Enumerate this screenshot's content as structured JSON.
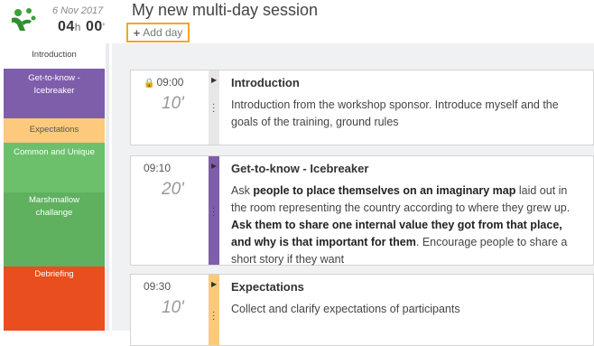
{
  "header": {
    "date": "6 Nov 2017",
    "hours": "04",
    "hours_unit": "h",
    "minutes": "00",
    "minutes_unit": "'",
    "title": "My new multi-day session",
    "add_day_label": "Add day"
  },
  "colors": {
    "accent": "#f5a623",
    "introduction": "#ffffff",
    "get_to_know": "#7e5eab",
    "expectations": "#fcc97d",
    "common_unique": "#6cc06c",
    "marshmallow": "#5fb05f",
    "debriefing": "#e94e1e"
  },
  "timeline": [
    {
      "label": "Introduction"
    },
    {
      "label": "Get-to-know - Icebreaker"
    },
    {
      "label": "Expectations"
    },
    {
      "label": "Common and Unique"
    },
    {
      "label": "Marshmallow challange"
    },
    {
      "label": "Debriefing"
    }
  ],
  "cards": [
    {
      "time": "09:00",
      "locked": true,
      "duration": "10'",
      "title": "Introduction",
      "description": "Introduction from the workshop sponsor. Introduce myself and the goals of the training, ground rules"
    },
    {
      "time": "09:10",
      "duration": "20'",
      "title": "Get-to-know - Icebreaker",
      "desc_parts": [
        "Ask ",
        "people to place themselves on an imaginary map",
        " laid out in the room representing the country according to where they grew up.  ",
        "Ask them to share one internal value they got from that place, and why is that important for them",
        ". Encourage people to share a short story if they want"
      ]
    },
    {
      "time": "09:30",
      "duration": "10'",
      "title": "Expectations",
      "description": "Collect and clarify expectations of participants"
    }
  ]
}
